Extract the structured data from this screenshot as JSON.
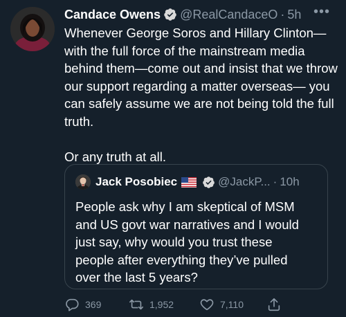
{
  "tweet": {
    "author_name": "Candace Owens",
    "author_handle": "@RealCandaceO",
    "time": "5h",
    "more_icon": "more-icon",
    "paragraphs": [
      "Whenever George Soros and Hillary Clinton—with the full force of the mainstream media behind them—come out and insist that we throw our support regarding a matter overseas— you can safely assume we are not being told the full truth.",
      "Or any truth at all."
    ]
  },
  "quoted_tweet": {
    "author_name": "Jack Posobiec",
    "flag": "🇺🇸",
    "author_handle": "@JackP...",
    "time": "10h",
    "text": "People ask why I am skeptical of MSM and US govt war narratives and I would just say, why would you trust these people after everything they’ve pulled over the last 5 years?"
  },
  "actions": {
    "replies": "369",
    "retweets": "1,952",
    "likes": "7,110"
  },
  "colors": {
    "background": "#15202b",
    "secondary_text": "#8b98a5",
    "verified": "#1d9bf0",
    "border": "#38444d"
  }
}
